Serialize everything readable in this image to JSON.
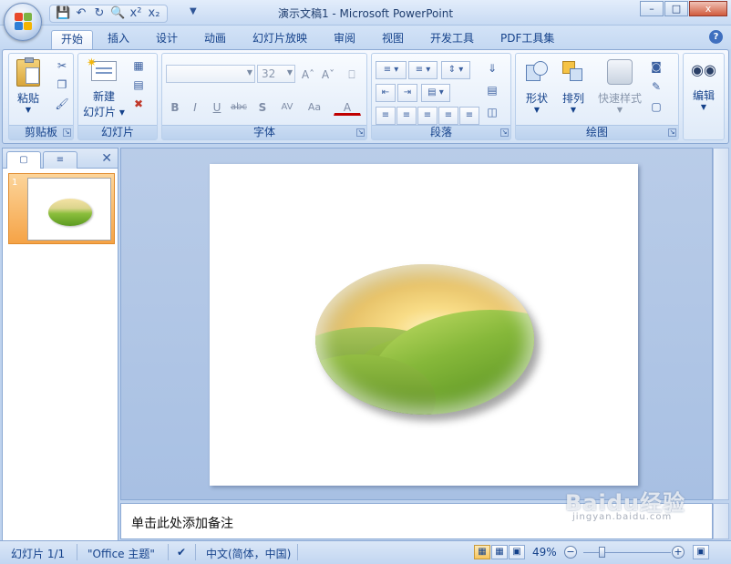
{
  "window": {
    "title": "演示文稿1 - Microsoft PowerPoint",
    "controls": {
      "minimize": "–",
      "maximize": "□",
      "close": "x"
    }
  },
  "ribbon_tabs": [
    "开始",
    "插入",
    "设计",
    "动画",
    "幻灯片放映",
    "审阅",
    "视图",
    "开发工具",
    "PDF工具集"
  ],
  "active_tab": "开始",
  "help_label": "?",
  "groups": {
    "clipboard": {
      "label": "剪贴板",
      "paste": "粘贴"
    },
    "slides": {
      "label": "幻灯片",
      "new_slide_line1": "新建",
      "new_slide_line2": "幻灯片"
    },
    "font": {
      "label": "字体",
      "font_size": "32",
      "bold": "B",
      "italic": "I",
      "underline": "U",
      "strike": "abc",
      "shadow": "S",
      "spacing": "AV",
      "case": "Aa",
      "color": "A"
    },
    "paragraph": {
      "label": "段落"
    },
    "drawing": {
      "label": "绘图",
      "shape": "形状",
      "arrange": "排列",
      "quick_style": "快速样式"
    },
    "editing": {
      "label": "编辑"
    }
  },
  "slide_pane": {
    "slide_number": "1"
  },
  "notes_placeholder": "单击此处添加备注",
  "status": {
    "slide": "幻灯片 1/1",
    "theme": "\"Office 主题\"",
    "language": "中文(简体，中国)",
    "zoom": "49%",
    "zoom_level": 0.49
  },
  "watermark": {
    "text": "Baidu经验",
    "sub": "jingyan.baidu.com"
  }
}
